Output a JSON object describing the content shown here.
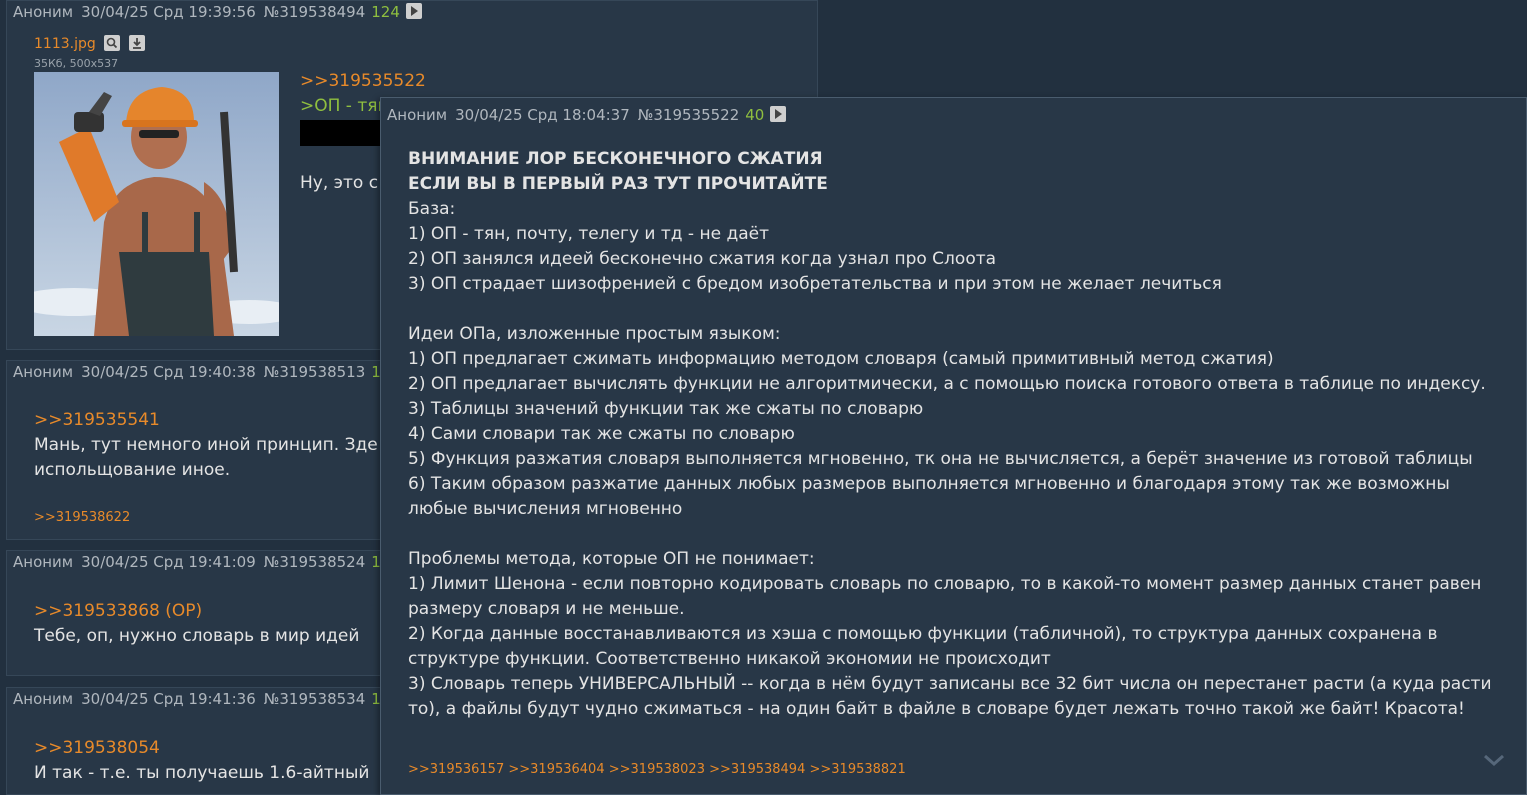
{
  "post1": {
    "author": "Аноним",
    "date": "30/04/25 Срд 19:39:56",
    "num": "№319538494",
    "count": "124",
    "file_name": "1113.jpg",
    "file_meta": "35Кб, 500x537",
    "reply_link": ">>319535522",
    "greentext": ">ОП - тян",
    "text": "Ну, это с"
  },
  "post2": {
    "author": "Аноним",
    "date": "30/04/25 Срд 19:40:38",
    "num": "№319538513",
    "count": "1",
    "reply_link": ">>319535541",
    "line1": "Мань, тут немного иной принцип. Зде",
    "line2": "испольщование иное.",
    "backlink": ">>319538622"
  },
  "post3": {
    "author": "Аноним",
    "date": "30/04/25 Срд 19:41:09",
    "num": "№319538524",
    "count": "1",
    "reply_link": ">>319533868 (OP)",
    "line1": "Тебе, оп, нужно словарь в мир идей"
  },
  "post4": {
    "author": "Аноним",
    "date": "30/04/25 Срд 19:41:36",
    "num": "№319538534",
    "count": "1",
    "reply_link": ">>319538054",
    "line1": "И так - т.е. ты получаешь 1.6-айтный"
  },
  "popup": {
    "author": "Аноним",
    "date": "30/04/25 Срд 18:04:37",
    "num": "№319535522",
    "count": "40",
    "bold1": "ВНИМАНИЕ ЛОР БЕСКОНЕЧНОГО СЖАТИЯ",
    "bold2": "ЕСЛИ ВЫ В ПЕРВЫЙ РАЗ ТУТ ПРОЧИТАЙТЕ",
    "lines": [
      "База:",
      "1) ОП - тян, почту, телегу и тд - не даёт",
      "2) ОП занялся идеей бесконечно сжатия когда узнал про Слоота",
      "3) ОП страдает шизофренией с бредом изобретательства и при этом не желает лечиться",
      "",
      "Идеи ОПа, изложенные простым языком:",
      "1) ОП предлагает сжимать информацию методом словаря (самый примитивный метод сжатия)",
      "2) ОП предлагает вычислять функции не алгоритмически, а с помощью поиска готового ответа в таблице по индексу.",
      "3) Таблицы значений функции так же сжаты по словарю",
      "4) Сами словари так же сжаты по словарю",
      "5) Функция разжатия словаря выполняется мгновенно, тк она не вычисляется, а берёт значение из готовой таблицы",
      "6) Таким образом разжатие данных любых размеров выполняется мгновенно и благодаря этому так же возможны",
      "любые вычисления мгновенно",
      "",
      "Проблемы метода, которые ОП не понимает:",
      "1) Лимит Шенона - если повторно кодировать словарь по словарю, то в какой-то момент размер данных станет равен",
      "размеру словаря и не меньше.",
      "2) Когда данные восстанавливаются из хэша с помощью функции (табличной), то структура данных сохранена в",
      "структуре функции. Соответственно никакой экономии не происходит",
      "3) Словарь теперь УНИВЕРСАЛЬНЫЙ -- когда в нём будут записаны все 32 бит числа он перестанет расти (а куда расти",
      "то), а файлы будут чудно сжиматься - на один байт в файле в словаре будет лежать точно такой же байт! Красота!"
    ],
    "replies": [
      ">>319536157",
      ">>319536404",
      ">>319538023",
      ">>319538494",
      ">>319538821"
    ]
  }
}
